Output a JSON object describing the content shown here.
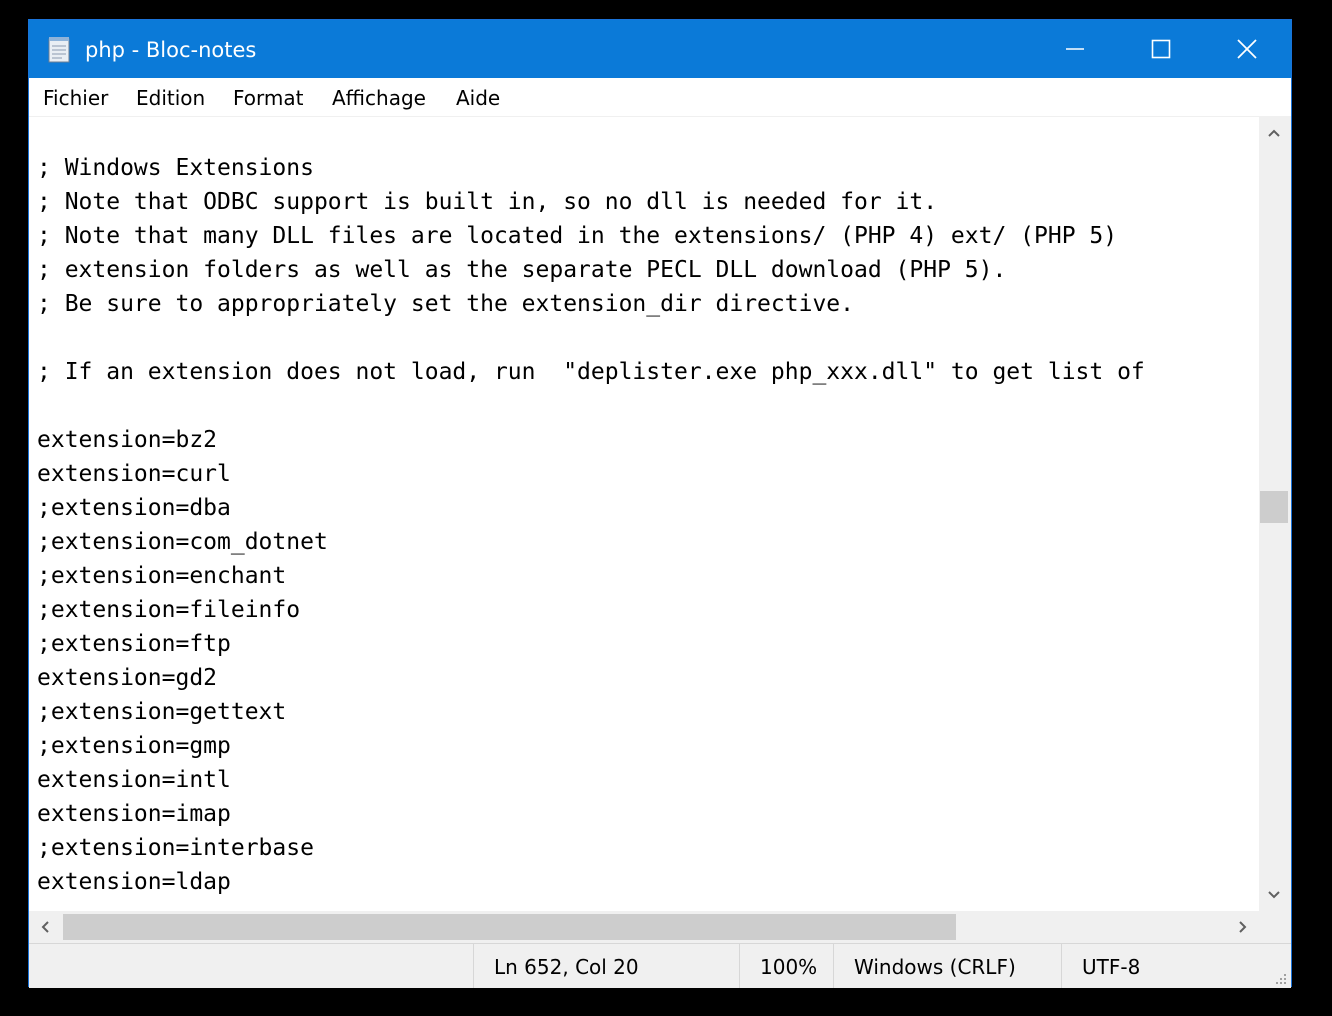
{
  "window": {
    "title": "php - Bloc-notes"
  },
  "menu": {
    "items": [
      "Fichier",
      "Edition",
      "Format",
      "Affichage",
      "Aide"
    ]
  },
  "editor": {
    "lines": [
      "",
      "; Windows Extensions",
      "; Note that ODBC support is built in, so no dll is needed for it.",
      "; Note that many DLL files are located in the extensions/ (PHP 4) ext/ (PHP 5)",
      "; extension folders as well as the separate PECL DLL download (PHP 5).",
      "; Be sure to appropriately set the extension_dir directive.",
      "",
      "; If an extension does not load, run  \"deplister.exe php_xxx.dll\" to get list of",
      "",
      "extension=bz2",
      "extension=curl",
      ";extension=dba",
      ";extension=com_dotnet",
      ";extension=enchant",
      ";extension=fileinfo",
      ";extension=ftp",
      "extension=gd2",
      ";extension=gettext",
      ";extension=gmp",
      "extension=intl",
      "extension=imap",
      ";extension=interbase",
      "extension=ldap"
    ]
  },
  "status": {
    "position": "Ln 652, Col 20",
    "zoom": "100%",
    "line_ending": "Windows (CRLF)",
    "encoding": "UTF-8"
  },
  "colors": {
    "titlebar": "#0b7ad8",
    "chrome": "#f0f0f0",
    "scroll_thumb": "#cdcdcd"
  },
  "icons": {
    "app": "notepad-icon",
    "minimize": "minimize-icon",
    "maximize": "maximize-icon",
    "close": "close-icon"
  }
}
